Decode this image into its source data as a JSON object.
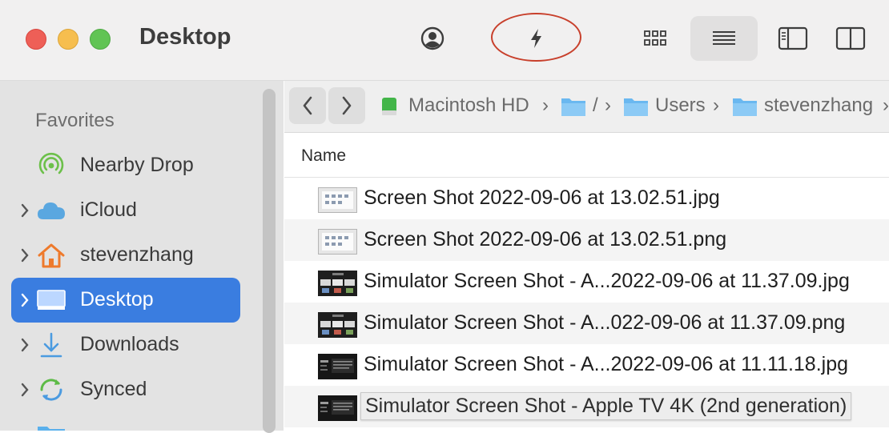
{
  "window": {
    "title": "Desktop"
  },
  "toolbar": {
    "account_icon": "person-circle-icon",
    "quick_action_icon": "bolt-icon",
    "grid_view_icon": "grid-icon",
    "list_view_icon": "list-icon",
    "sidebar_icon": "sidebar-icon",
    "split_icon": "split-view-icon"
  },
  "sidebar": {
    "header": "Favorites",
    "items": [
      {
        "label": "Nearby Drop",
        "icon": "airdrop-icon",
        "expandable": false,
        "selected": false
      },
      {
        "label": "iCloud",
        "icon": "cloud-icon",
        "expandable": true,
        "selected": false
      },
      {
        "label": "stevenzhang",
        "icon": "home-icon",
        "expandable": true,
        "selected": false
      },
      {
        "label": "Desktop",
        "icon": "desktop-icon",
        "expandable": true,
        "selected": true
      },
      {
        "label": "Downloads",
        "icon": "download-icon",
        "expandable": true,
        "selected": false
      },
      {
        "label": "Synced",
        "icon": "sync-icon",
        "expandable": true,
        "selected": false
      }
    ]
  },
  "pathbar": {
    "crumbs": [
      "Macintosh HD",
      "/",
      "Users",
      "stevenzhang"
    ],
    "separator": "›"
  },
  "list": {
    "column_name": "Name",
    "files": [
      {
        "name": "Screen Shot 2022-09-06 at 13.02.51.jpg",
        "thumb": "light"
      },
      {
        "name": "Screen Shot 2022-09-06 at 13.02.51.png",
        "thumb": "light"
      },
      {
        "name": "Simulator Screen Shot - A...2022-09-06 at 11.37.09.jpg",
        "thumb": "tv-light"
      },
      {
        "name": "Simulator Screen Shot - A...022-09-06 at 11.37.09.png",
        "thumb": "tv-light"
      },
      {
        "name": "Simulator Screen Shot - A...2022-09-06 at 11.11.18.jpg",
        "thumb": "tv-dark"
      },
      {
        "name": "Simulator Screen Shot - Apple TV 4K (2nd generation)",
        "thumb": "tv-dark"
      }
    ]
  },
  "colors": {
    "accent": "#3a7de0",
    "annotation": "#c8402c"
  }
}
